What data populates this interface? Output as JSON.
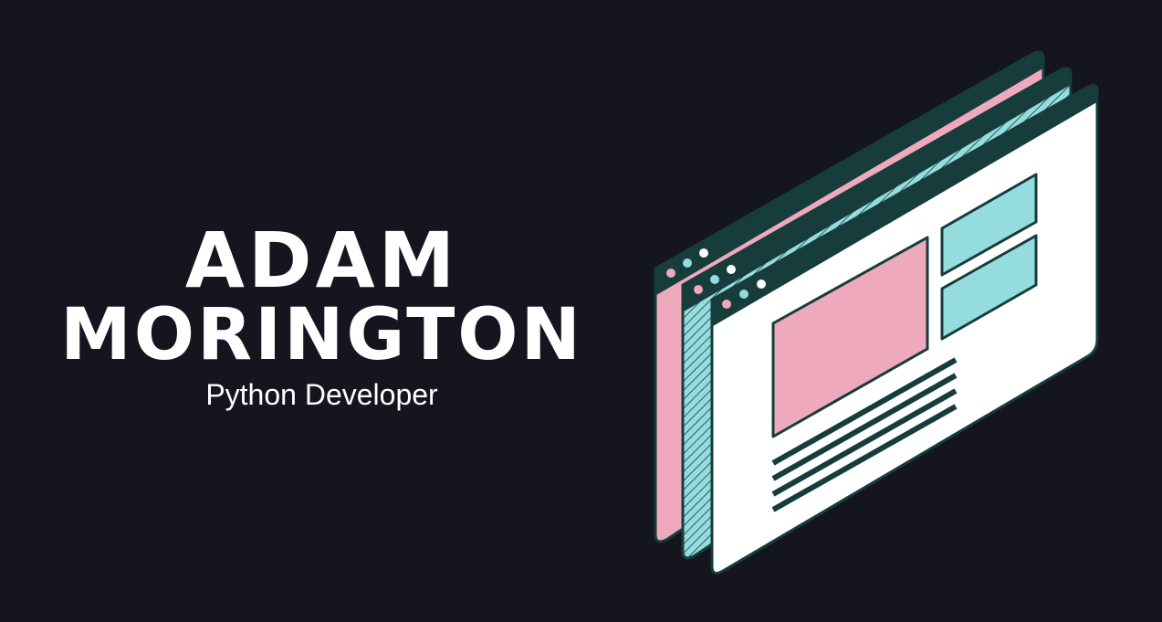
{
  "hero": {
    "first_name": "ADAM",
    "last_name": "MORINGTON",
    "role": "Python Developer"
  },
  "illustration": {
    "icon": "browser-windows-icon",
    "colors": {
      "frame": "#173C3C",
      "pink": "#EFA9BD",
      "teal": "#94DCDD",
      "white": "#FFFFFF",
      "background": "#151520"
    }
  }
}
